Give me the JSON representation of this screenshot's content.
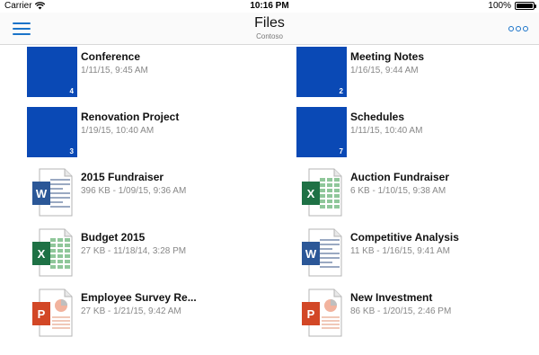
{
  "status_bar": {
    "carrier": "Carrier",
    "time": "10:16 PM",
    "battery": "100%",
    "battery_level": 1.0
  },
  "nav": {
    "title": "Files",
    "subtitle": "Contoso",
    "menu_icon": "hamburger-menu-icon",
    "more_icon": "more-options-icon"
  },
  "colors": {
    "accent": "#1a73c9",
    "folder": "#0a49b5",
    "word": "#2b5797",
    "excel": "#1e7145",
    "powerpoint": "#d24726"
  },
  "files": [
    {
      "name": "Conference",
      "meta": "1/11/15, 9:45 AM",
      "kind": "folder",
      "count": "4"
    },
    {
      "name": "Meeting Notes",
      "meta": "1/16/15, 9:44 AM",
      "kind": "folder",
      "count": "2"
    },
    {
      "name": "Renovation Project",
      "meta": "1/19/15, 10:40 AM",
      "kind": "folder",
      "count": "3"
    },
    {
      "name": "Schedules",
      "meta": "1/11/15, 10:40 AM",
      "kind": "folder",
      "count": "7"
    },
    {
      "name": "2015 Fundraiser",
      "meta": "396 KB - 1/09/15, 9:36 AM",
      "kind": "word",
      "badge": "W"
    },
    {
      "name": "Auction Fundraiser",
      "meta": "6 KB - 1/10/15, 9:38 AM",
      "kind": "excel",
      "badge": "X"
    },
    {
      "name": "Budget 2015",
      "meta": "27 KB - 11/18/14, 3:28 PM",
      "kind": "excel",
      "badge": "X"
    },
    {
      "name": "Competitive Analysis",
      "meta": "11 KB - 1/16/15, 9:41 AM",
      "kind": "word",
      "badge": "W"
    },
    {
      "name": "Employee Survey Re...",
      "meta": "27 KB - 1/21/15, 9:42 AM",
      "kind": "powerpoint",
      "badge": "P"
    },
    {
      "name": "New Investment",
      "meta": "86 KB - 1/20/15, 2:46 PM",
      "kind": "powerpoint",
      "badge": "P"
    }
  ]
}
